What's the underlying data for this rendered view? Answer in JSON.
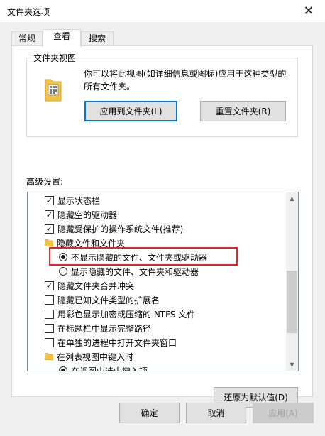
{
  "window": {
    "title": "文件夹选项"
  },
  "tabs": [
    {
      "label": "常规"
    },
    {
      "label": "查看"
    },
    {
      "label": "搜索"
    }
  ],
  "folder_views": {
    "group_label": "文件夹视图",
    "description": "你可以将此视图(如详细信息或图标)应用于这种类型的所有文件夹。",
    "apply_button": "应用到文件夹(L)",
    "reset_button": "重置文件夹(R)"
  },
  "advanced": {
    "label": "高级设置:",
    "items": [
      {
        "type": "checkbox",
        "checked": true,
        "label": "显示状态栏"
      },
      {
        "type": "checkbox",
        "checked": true,
        "label": "隐藏空的驱动器"
      },
      {
        "type": "checkbox",
        "checked": true,
        "label": "隐藏受保护的操作系统文件(推荐)"
      },
      {
        "type": "folder",
        "label": "隐藏文件和文件夹"
      },
      {
        "type": "radio",
        "checked": true,
        "label": "不显示隐藏的文件、文件夹或驱动器"
      },
      {
        "type": "radio",
        "checked": false,
        "label": "显示隐藏的文件、文件夹和驱动器"
      },
      {
        "type": "checkbox",
        "checked": true,
        "label": "隐藏文件夹合并冲突"
      },
      {
        "type": "checkbox",
        "checked": false,
        "label": "隐藏已知文件类型的扩展名"
      },
      {
        "type": "checkbox",
        "checked": false,
        "label": "用彩色显示加密或压缩的 NTFS 文件"
      },
      {
        "type": "checkbox",
        "checked": false,
        "label": "在标题栏中显示完整路径"
      },
      {
        "type": "checkbox",
        "checked": false,
        "label": "在单独的进程中打开文件夹窗口"
      },
      {
        "type": "folder",
        "label": "在列表视图中键入时"
      },
      {
        "type": "radio",
        "checked": true,
        "label": "在视图中选中键入项"
      }
    ],
    "restore_button": "还原为默认值(D)"
  },
  "footer": {
    "ok_button": "确定",
    "cancel_button": "取消",
    "apply_button": "应用(A)"
  },
  "colors": {
    "highlight_border": "#e0262c",
    "focus_border": "#0078d7",
    "folder_yellow": "#f5c342"
  }
}
